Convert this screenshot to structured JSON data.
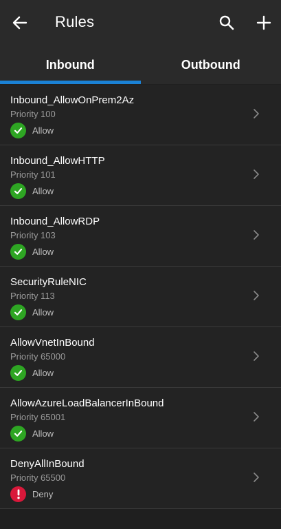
{
  "header": {
    "title": "Rules"
  },
  "tabs": [
    {
      "label": "Inbound",
      "selected": true
    },
    {
      "label": "Outbound",
      "selected": false
    }
  ],
  "colors": {
    "accent": "#1b82d6",
    "allow": "#2ea523",
    "deny": "#d9183a"
  },
  "rules": [
    {
      "name": "Inbound_AllowOnPrem2Az",
      "priority": "Priority 100",
      "action": "Allow"
    },
    {
      "name": "Inbound_AllowHTTP",
      "priority": "Priority 101",
      "action": "Allow"
    },
    {
      "name": "Inbound_AllowRDP",
      "priority": "Priority 103",
      "action": "Allow"
    },
    {
      "name": "SecurityRuleNIC",
      "priority": "Priority 113",
      "action": "Allow"
    },
    {
      "name": "AllowVnetInBound",
      "priority": "Priority 65000",
      "action": "Allow"
    },
    {
      "name": "AllowAzureLoadBalancerInBound",
      "priority": "Priority 65001",
      "action": "Allow"
    },
    {
      "name": "DenyAllInBound",
      "priority": "Priority 65500",
      "action": "Deny"
    }
  ]
}
